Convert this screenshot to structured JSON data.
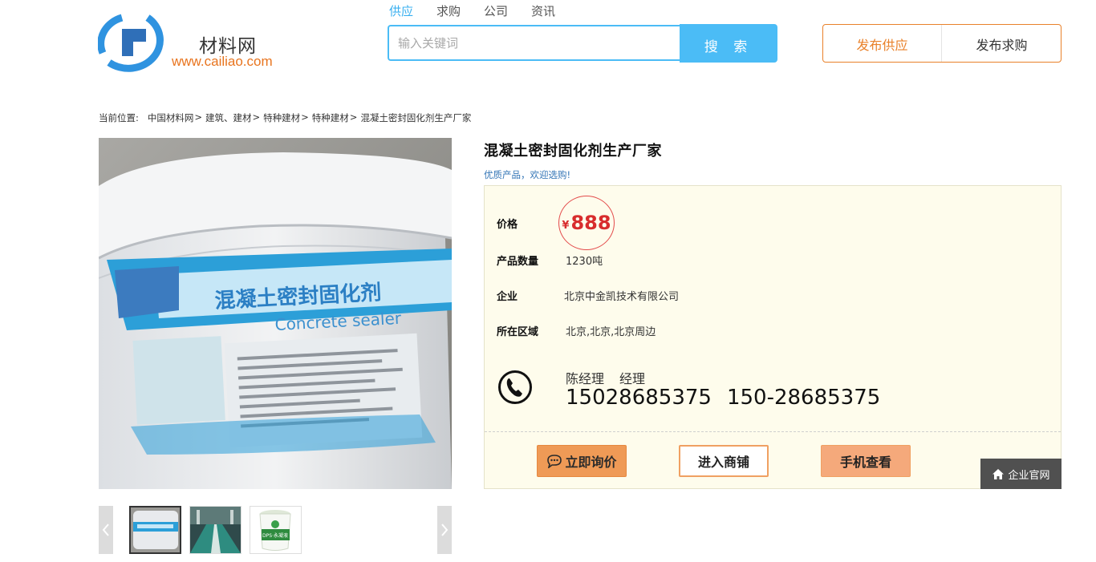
{
  "site": {
    "name": "材料网",
    "url": "www.cailiao.com",
    "colors": {
      "accent_blue": "#4bbcf6",
      "accent_orange": "#e9812a",
      "price_red": "#d82d2d"
    }
  },
  "search": {
    "tabs": [
      {
        "label": "供应",
        "active": true
      },
      {
        "label": "求购",
        "active": false
      },
      {
        "label": "公司",
        "active": false
      },
      {
        "label": "资讯",
        "active": false
      }
    ],
    "placeholder": "输入关键词",
    "value": "",
    "button_label": "搜 索"
  },
  "publish": {
    "supply_label": "发布供应",
    "purchase_label": "发布求购"
  },
  "breadcrumb": {
    "label": "当前位置:",
    "items": [
      "中国材料网",
      "建筑、建材",
      "特种建材",
      "特种建材"
    ],
    "separator": ">",
    "current": "混凝土密封固化剂生产厂家"
  },
  "gallery": {
    "prev_icon": "chevron-left-icon",
    "next_icon": "chevron-right-icon",
    "main_image_text": {
      "product_name_cn": "混凝土密封固化剂",
      "product_name_en": "Concrete sealer"
    },
    "thumbnails": [
      {
        "name": "bucket-photo-thumb",
        "active": true
      },
      {
        "name": "floor-photo-thumb",
        "active": false
      },
      {
        "name": "green-bucket-thumb",
        "active": false,
        "text": "DPS·永凝液"
      }
    ]
  },
  "product": {
    "title": "混凝土密封固化剂生产厂家",
    "subtitle": "优质产品，欢迎选购!",
    "price": {
      "label": "价格",
      "currency": "¥",
      "value": "888"
    },
    "quantity": {
      "label": "产品数量",
      "value": "1230吨"
    },
    "company": {
      "label": "企业",
      "value": "北京中金凯技术有限公司"
    },
    "region": {
      "label": "所在区域",
      "value": "北京,北京,北京周边"
    },
    "contact": {
      "icon": "phone-icon",
      "name": "陈经理",
      "title": "经理",
      "phone_1": "15028685375",
      "phone_2": "150-28685375"
    },
    "actions": {
      "inquire_label": "立即询价",
      "inquire_icon": "chat-bubble-icon",
      "shop_label": "进入商铺",
      "mobile_label": "手机查看"
    },
    "official_site": {
      "label": "企业官网",
      "icon": "home-icon"
    }
  }
}
